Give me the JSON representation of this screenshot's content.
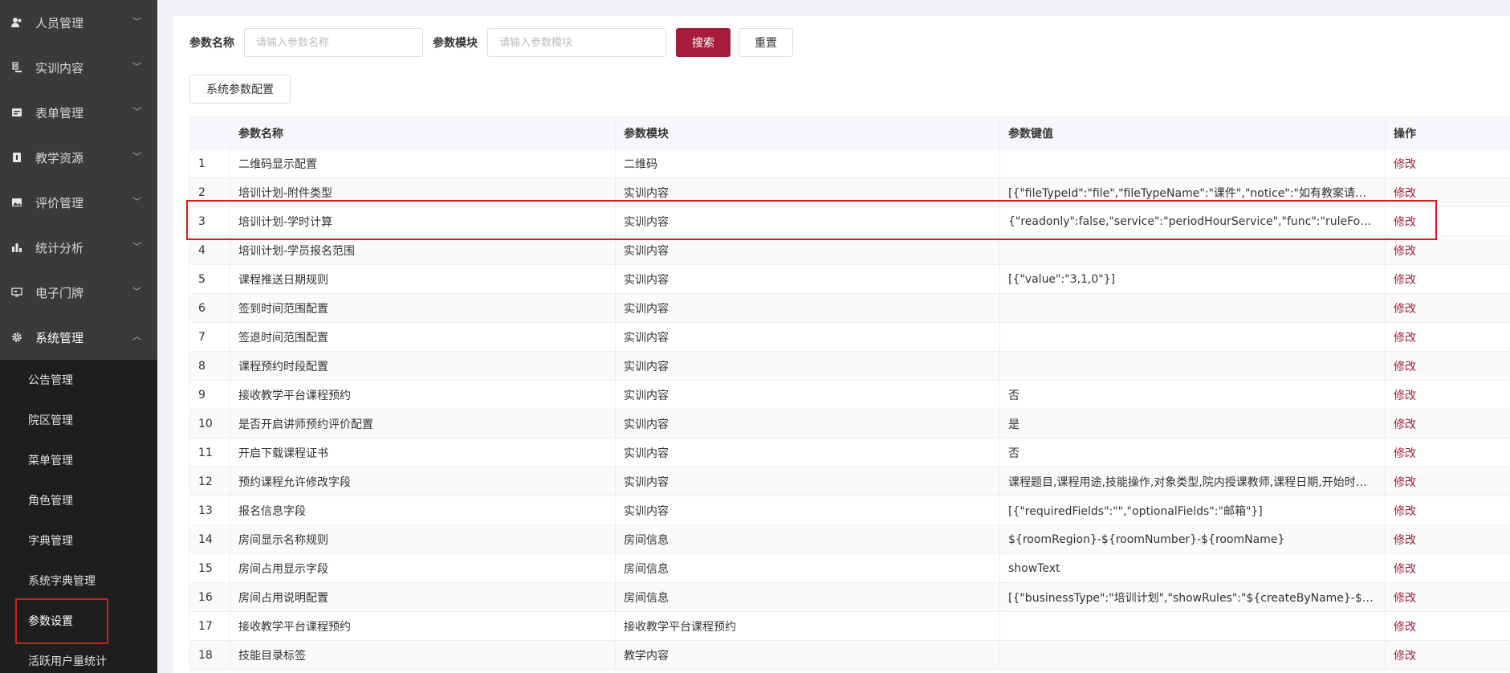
{
  "sidebar": {
    "menus": [
      {
        "label": "人员管理",
        "icon": "user-icon"
      },
      {
        "label": "实训内容",
        "icon": "document-icon"
      },
      {
        "label": "表单管理",
        "icon": "form-icon"
      },
      {
        "label": "教学资源",
        "icon": "book-icon"
      },
      {
        "label": "评价管理",
        "icon": "image-icon"
      },
      {
        "label": "统计分析",
        "icon": "bar-chart-icon"
      },
      {
        "label": "电子门牌",
        "icon": "monitor-icon"
      },
      {
        "label": "系统管理",
        "icon": "gear-icon"
      }
    ],
    "submenu": [
      {
        "label": "公告管理"
      },
      {
        "label": "院区管理"
      },
      {
        "label": "菜单管理"
      },
      {
        "label": "角色管理"
      },
      {
        "label": "字典管理"
      },
      {
        "label": "系统字典管理"
      },
      {
        "label": "参数设置"
      },
      {
        "label": "活跃用户量统计"
      }
    ]
  },
  "search": {
    "name_label": "参数名称",
    "name_placeholder": "请输入参数名称",
    "module_label": "参数模块",
    "module_placeholder": "请输入参数模块",
    "search_button": "搜索",
    "reset_button": "重置"
  },
  "config_button": "系统参数配置",
  "table": {
    "headers": [
      "",
      "参数名称",
      "参数模块",
      "参数键值",
      "操作"
    ],
    "action_label": "修改",
    "rows": [
      {
        "no": "1",
        "name": "二维码显示配置",
        "module": "二维码",
        "value": ""
      },
      {
        "no": "2",
        "name": "培训计划-附件类型",
        "module": "实训内容",
        "value": "[{\"fileTypeId\":\"file\",\"fileTypeName\":\"课件\",\"notice\":\"如有教案请上传\",\"isRequired\":false}]"
      },
      {
        "no": "3",
        "name": "培训计划-学时计算",
        "module": "实训内容",
        "value": "{\"readonly\":false,\"service\":\"periodHourService\",\"func\":\"ruleFour\"}"
      },
      {
        "no": "4",
        "name": "培训计划-学员报名范围",
        "module": "实训内容",
        "value": ""
      },
      {
        "no": "5",
        "name": "课程推送日期规则",
        "module": "实训内容",
        "value": "[{\"value\":\"3,1,0\"}]"
      },
      {
        "no": "6",
        "name": "签到时间范围配置",
        "module": "实训内容",
        "value": ""
      },
      {
        "no": "7",
        "name": "签退时间范围配置",
        "module": "实训内容",
        "value": ""
      },
      {
        "no": "8",
        "name": "课程预约时段配置",
        "module": "实训内容",
        "value": ""
      },
      {
        "no": "9",
        "name": "接收教学平台课程预约",
        "module": "实训内容",
        "value": "否"
      },
      {
        "no": "10",
        "name": "是否开启讲师预约评价配置",
        "module": "实训内容",
        "value": "是"
      },
      {
        "no": "11",
        "name": "开启下载课程证书",
        "module": "实训内容",
        "value": "否"
      },
      {
        "no": "12",
        "name": "预约课程允许修改字段",
        "module": "实训内容",
        "value": "课程题目,课程用途,技能操作,对象类型,院内授课教师,课程日期,开始时间,结束时间"
      },
      {
        "no": "13",
        "name": "报名信息字段",
        "module": "实训内容",
        "value": "[{\"requiredFields\":\"\",\"optionalFields\":\"邮箱\"}]"
      },
      {
        "no": "14",
        "name": "房间显示名称规则",
        "module": "房间信息",
        "value": "${roomRegion}-${roomNumber}-${roomName}"
      },
      {
        "no": "15",
        "name": "房间占用显示字段",
        "module": "房间信息",
        "value": "showText"
      },
      {
        "no": "16",
        "name": "房间占用说明配置",
        "module": "房间信息",
        "value": "[{\"businessType\":\"培训计划\",\"showRules\":\"${createByName}-${courseName}\"}]"
      },
      {
        "no": "17",
        "name": "接收教学平台课程预约",
        "module": "接收教学平台课程预约",
        "value": ""
      },
      {
        "no": "18",
        "name": "技能目录标签",
        "module": "教学内容",
        "value": ""
      }
    ]
  }
}
